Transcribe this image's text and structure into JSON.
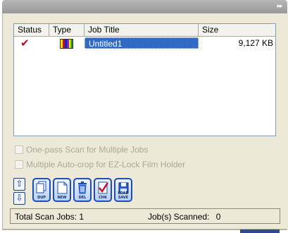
{
  "window": {
    "collapse_icon": "double-chevron-right"
  },
  "job_list": {
    "columns": [
      "Status",
      "Type",
      "Job Title",
      "Size"
    ],
    "rows": [
      {
        "status_icon": "check-icon",
        "type_icon": "color-film-icon",
        "title": "Untitled1",
        "size": "9,127 KB"
      }
    ]
  },
  "options": {
    "one_pass": "One-pass Scan for Multiple Jobs",
    "auto_crop": "Multiple Auto-crop for EZ-Lock Film Holder"
  },
  "toolbar": {
    "dup": "DUP",
    "new": "NEW",
    "del": "DEL",
    "chk": "CHK",
    "load_save": "LOAD SAVE"
  },
  "status": {
    "total_label": "Total Scan Jobs:",
    "total_value": "1",
    "scanned_label": "Job(s) Scanned:",
    "scanned_value": "0"
  }
}
